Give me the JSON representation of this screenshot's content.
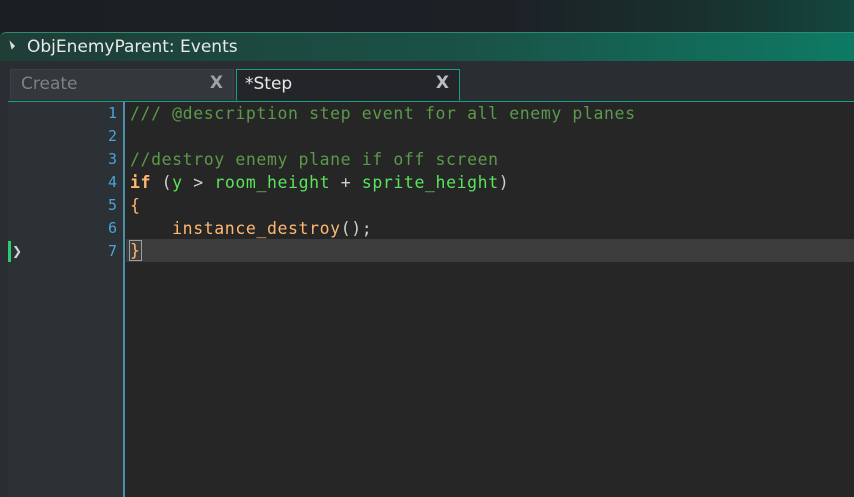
{
  "window": {
    "title": "ObjEnemyParent: Events"
  },
  "tabs": [
    {
      "label": "Create",
      "close": "X",
      "active": false
    },
    {
      "label": "*Step",
      "close": "X",
      "active": true
    }
  ],
  "editor": {
    "current_line": 7,
    "line_numbers": [
      "1",
      "2",
      "3",
      "4",
      "5",
      "6",
      "7"
    ],
    "lines": {
      "l1": {
        "comment": "/// @description step event for all enemy planes"
      },
      "l3": {
        "comment": "//destroy enemy plane if off screen"
      },
      "l4": {
        "kw": "if",
        "p1": " (",
        "var": "y",
        "op1": " > ",
        "b1": "room_height",
        "op2": " + ",
        "b2": "sprite_height",
        "p2": ")"
      },
      "l5": {
        "brace": "{"
      },
      "l6": {
        "indent": "    ",
        "func": "instance_destroy",
        "rest": "();"
      },
      "l7": {
        "brace": "}"
      }
    }
  },
  "colors": {
    "accent": "#16a085",
    "line_number": "#4aa3d6",
    "comment": "#5b9a4a",
    "keyword": "#ffb871",
    "builtin_var": "#58e55a",
    "variable": "#b2b1ff"
  }
}
